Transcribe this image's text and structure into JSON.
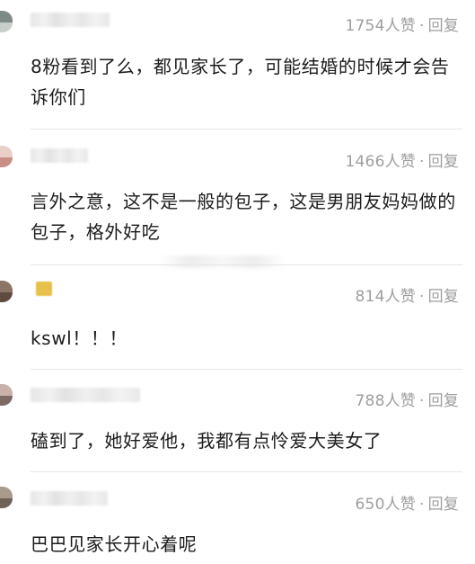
{
  "comments": [
    {
      "likes": "1754人赞",
      "reply": "回复",
      "text": "8粉看到了么，都见家长了，可能结婚的时候才会告诉你们",
      "avatar_colors": [
        "#7d8a86",
        "#c8cfcb"
      ]
    },
    {
      "likes": "1466人赞",
      "reply": "回复",
      "text": "言外之意，这不是一般的包子，这是男朋友妈妈做的包子，格外好吃",
      "avatar_colors": [
        "#e9cfc8",
        "#c98f86"
      ]
    },
    {
      "likes": "814人赞",
      "reply": "回复",
      "text": "kswl！！！",
      "avatar_colors": [
        "#8d7566",
        "#5e4a3f"
      ],
      "badge_color": "#e8c14a"
    },
    {
      "likes": "788人赞",
      "reply": "回复",
      "text": "磕到了，她好爱他，我都有点怜爱大美女了",
      "avatar_colors": [
        "#c9b0a8",
        "#7e6a64"
      ]
    },
    {
      "likes": "650人赞",
      "reply": "回复",
      "text": "巴巴见家长开心着呢",
      "avatar_colors": [
        "#a99a8c",
        "#6f6257"
      ]
    }
  ],
  "meta_separator": "·"
}
